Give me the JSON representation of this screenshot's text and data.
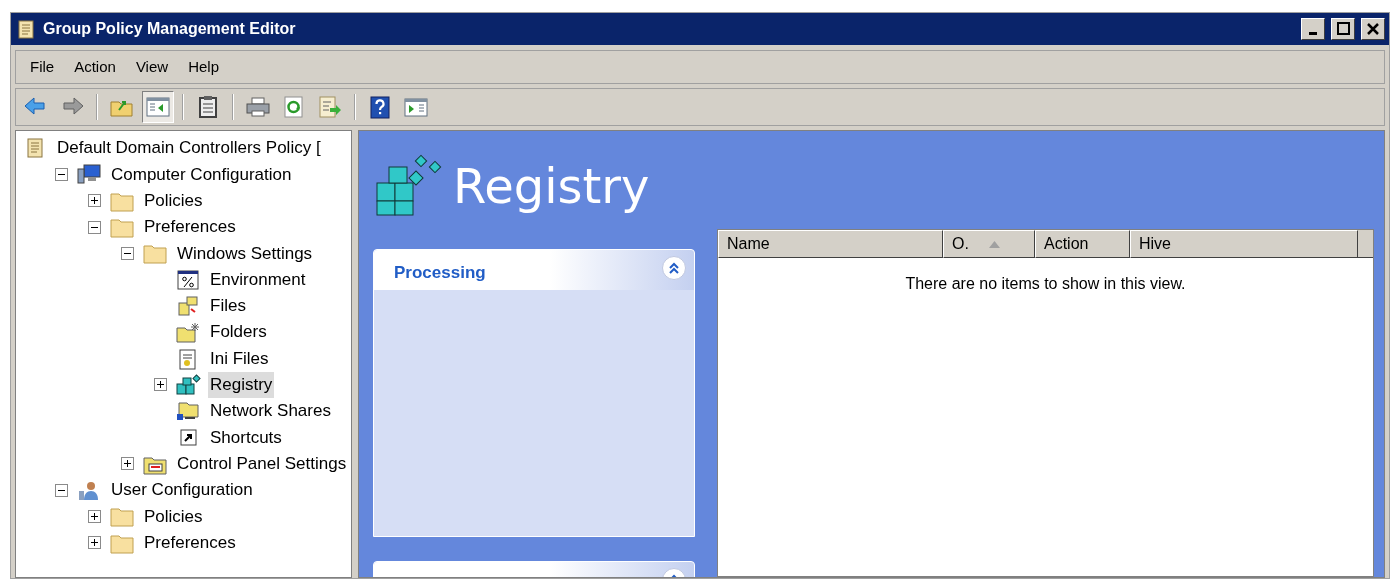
{
  "window": {
    "title": "Group Policy Management Editor"
  },
  "menu": [
    "File",
    "Action",
    "View",
    "Help"
  ],
  "toolbar": [
    {
      "kind": "back",
      "pressed": false
    },
    {
      "kind": "forward",
      "pressed": false
    },
    {
      "kind": "separator"
    },
    {
      "kind": "up",
      "pressed": false
    },
    {
      "kind": "tree",
      "pressed": true
    },
    {
      "kind": "separator"
    },
    {
      "kind": "properties",
      "pressed": false
    },
    {
      "kind": "separator"
    },
    {
      "kind": "print",
      "pressed": false
    },
    {
      "kind": "refresh",
      "pressed": false
    },
    {
      "kind": "export",
      "pressed": false
    },
    {
      "kind": "separator"
    },
    {
      "kind": "help",
      "pressed": false
    },
    {
      "kind": "actionpane",
      "pressed": false
    }
  ],
  "tree": [
    {
      "label": "Default Domain Controllers Policy [",
      "kind": "policy",
      "selected": false,
      "children": [
        {
          "label": "Computer Configuration",
          "kind": "computer",
          "expanded": true,
          "selected": false,
          "children": [
            {
              "label": "Policies",
              "kind": "folder",
              "expanded": false,
              "selected": false
            },
            {
              "label": "Preferences",
              "kind": "folder",
              "expanded": true,
              "selected": false,
              "children": [
                {
                  "label": "Windows Settings",
                  "kind": "folder",
                  "expanded": true,
                  "selected": false,
                  "children": [
                    {
                      "label": "Environment",
                      "kind": "environment",
                      "selected": false
                    },
                    {
                      "label": "Files",
                      "kind": "files",
                      "selected": false
                    },
                    {
                      "label": "Folders",
                      "kind": "folders",
                      "selected": false
                    },
                    {
                      "label": "Ini Files",
                      "kind": "ini",
                      "selected": false
                    },
                    {
                      "label": "Registry",
                      "kind": "registry",
                      "expanded": false,
                      "selected": true
                    },
                    {
                      "label": "Network Shares",
                      "kind": "shares",
                      "selected": false
                    },
                    {
                      "label": "Shortcuts",
                      "kind": "shortcut",
                      "selected": false
                    }
                  ]
                },
                {
                  "label": "Control Panel Settings",
                  "kind": "controlpanel",
                  "expanded": false,
                  "selected": false
                }
              ]
            }
          ]
        },
        {
          "label": "User Configuration",
          "kind": "user",
          "expanded": true,
          "selected": false,
          "children": [
            {
              "label": "Policies",
              "kind": "folder",
              "expanded": false,
              "selected": false
            },
            {
              "label": "Preferences",
              "kind": "folder",
              "expanded": false,
              "selected": false
            }
          ]
        }
      ]
    }
  ],
  "content": {
    "title": "Registry",
    "panels": [
      {
        "title": "Processing",
        "expanded": true
      },
      {
        "expanded": true
      }
    ],
    "table": {
      "columns": [
        {
          "label": "Name"
        },
        {
          "label": "O.",
          "sorted": true
        },
        {
          "label": "Action"
        },
        {
          "label": "Hive"
        }
      ],
      "empty_text": "There are no items to show in this view."
    }
  }
}
